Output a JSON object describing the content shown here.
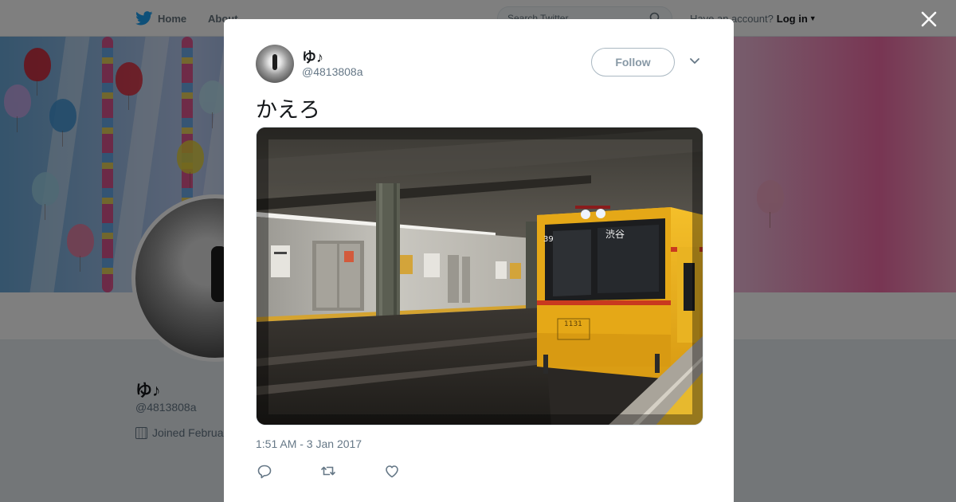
{
  "topbar": {
    "home_label": "Home",
    "about_label": "About",
    "search_placeholder": "Search Twitter",
    "have_account_text": "Have an account?",
    "login_label": "Log in"
  },
  "profile": {
    "name": "ゆ♪",
    "handle": "@4813808a",
    "joined_text": "Joined Februa"
  },
  "tweet": {
    "author_name": "ゆ♪",
    "author_handle": "@4813808a",
    "follow_label": "Follow",
    "text": "かえろ",
    "timestamp": "1:51 AM - 3 Jan 2017"
  },
  "media": {
    "train_number": "1131",
    "destination_text": "渋谷",
    "route_number": "39"
  },
  "colors": {
    "twitter_blue": "#1da1f2",
    "text_primary": "#14171a",
    "text_secondary": "#657786",
    "train_yellow": "#f2b21b"
  },
  "icons": {
    "brand": "twitter-bird-icon",
    "search": "search-icon",
    "close": "close-icon",
    "menu": "chevron-down-icon",
    "reply": "reply-icon",
    "retweet": "retweet-icon",
    "like": "heart-icon",
    "calendar": "calendar-icon"
  }
}
